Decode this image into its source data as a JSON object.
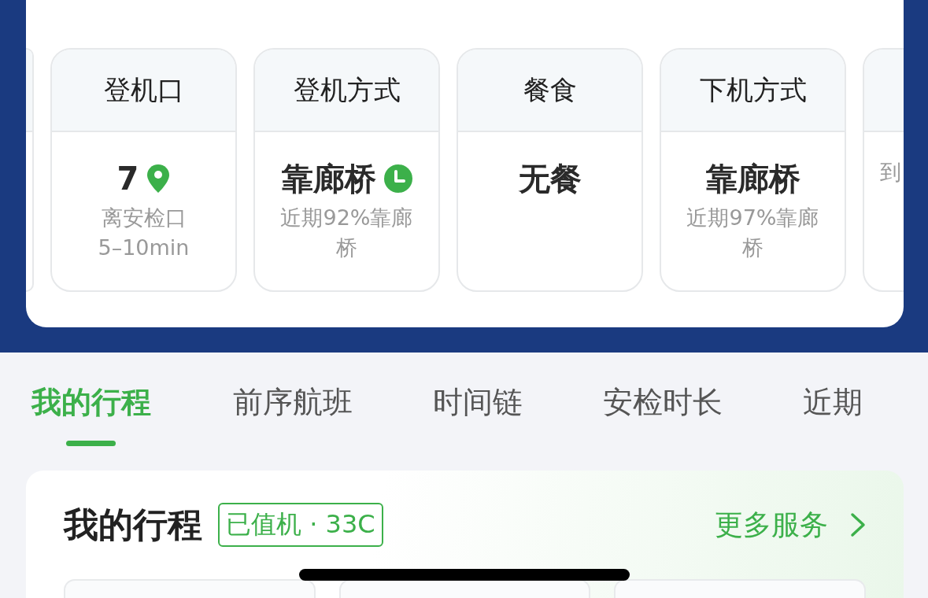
{
  "info_cards": [
    {
      "kind": "edge"
    },
    {
      "kind": "gate",
      "header": "登机口",
      "value": "7",
      "note_lines": [
        "离安检口",
        "5–10min"
      ]
    },
    {
      "kind": "boarding",
      "header": "登机方式",
      "value": "靠廊桥",
      "note_lines": [
        "近期92%靠廊",
        "桥"
      ]
    },
    {
      "kind": "plain",
      "header": "餐食",
      "value": "无餐"
    },
    {
      "kind": "plain",
      "header": "下机方式",
      "value": "靠廊桥",
      "note_lines": [
        "近期97%靠廊",
        "桥"
      ]
    },
    {
      "kind": "edge",
      "note_lines": [
        "到"
      ]
    }
  ],
  "tabs": [
    {
      "label": "我的行程",
      "selected": true
    },
    {
      "label": "前序航班",
      "selected": false
    },
    {
      "label": "时间链",
      "selected": false
    },
    {
      "label": "安检时长",
      "selected": false
    },
    {
      "label": "近期",
      "selected": false
    }
  ],
  "trip": {
    "title": "我的行程",
    "badge": "已值机 · 33C",
    "more": "更多服务"
  }
}
